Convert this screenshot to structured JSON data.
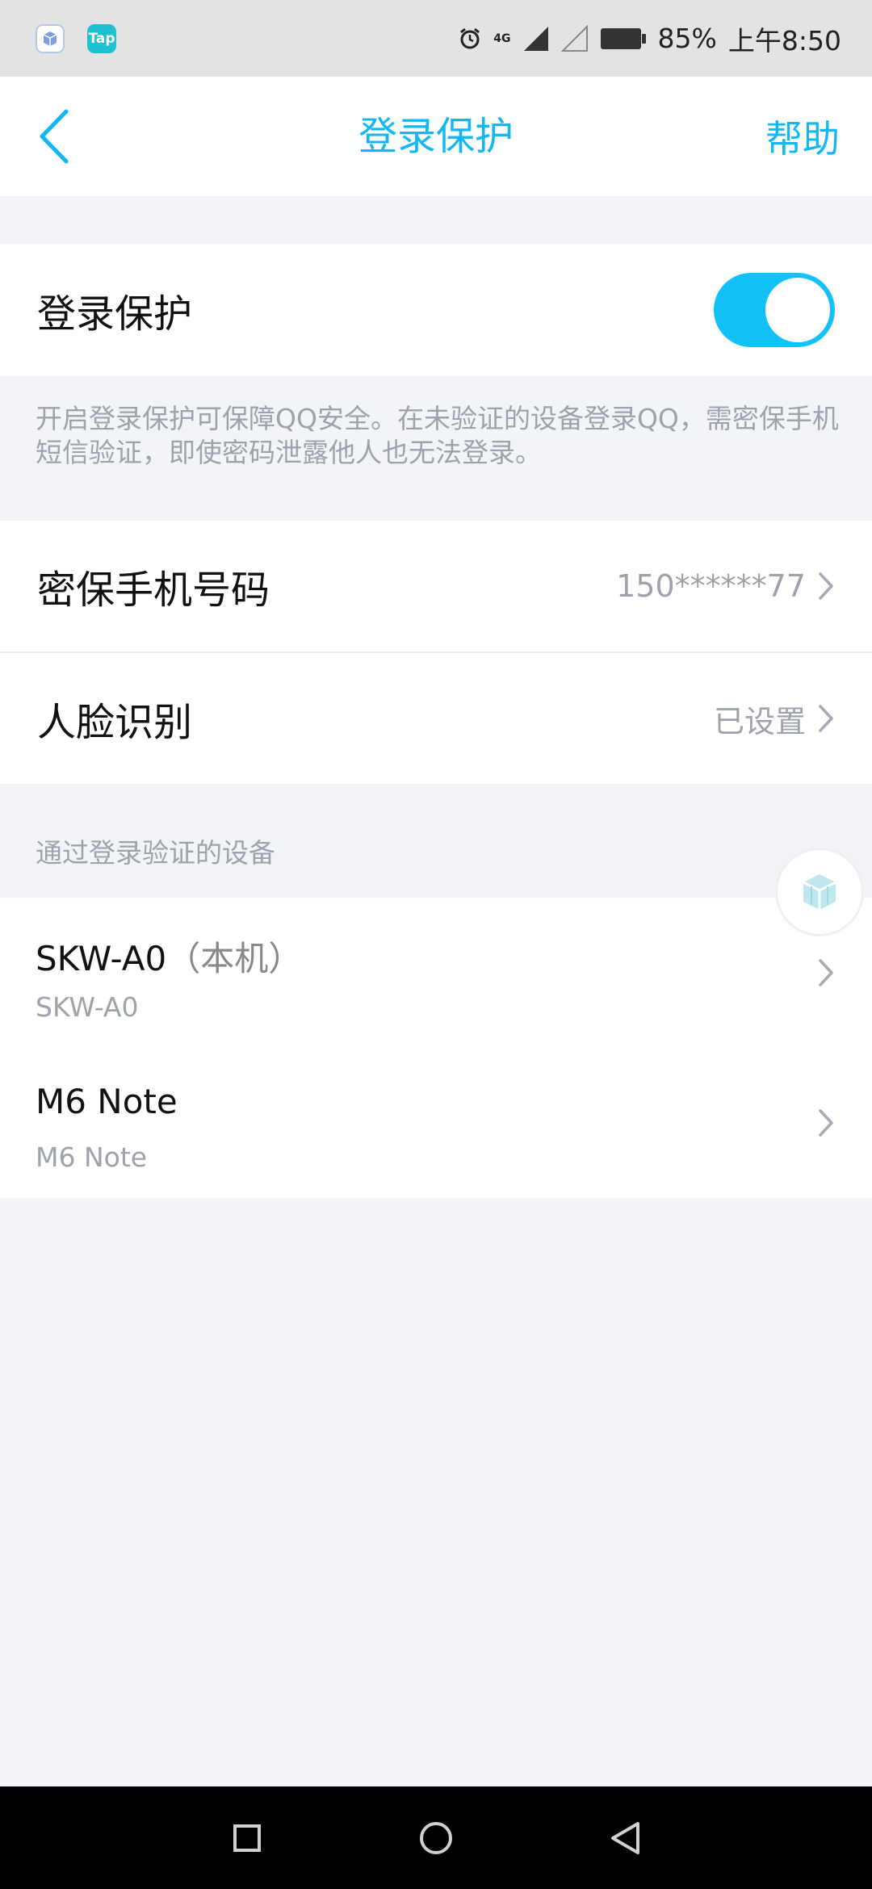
{
  "status_bar": {
    "battery_percent": "85%",
    "time": "上午8:50",
    "network_label": "4G",
    "tap_badge": "Tap",
    "icons": [
      "app-cube-icon",
      "tap-app-icon",
      "alarm-icon",
      "signal-icon",
      "signal-empty-icon",
      "battery-icon"
    ]
  },
  "nav": {
    "title": "登录保护",
    "help": "帮助",
    "back_icon": "chevron-left-icon"
  },
  "login_protect": {
    "label": "登录保护",
    "enabled": true,
    "description": "开启登录保护可保障QQ安全。在未验证的设备登录QQ，需密保手机短信验证，即使密码泄露他人也无法登录。"
  },
  "security_phone": {
    "label": "密保手机号码",
    "value": "150******77"
  },
  "face_recognition": {
    "label": "人脸识别",
    "value": "已设置"
  },
  "devices_section": {
    "title": "通过登录验证的设备",
    "items": [
      {
        "name": "SKW-A0",
        "suffix": "（本机）",
        "model": "SKW-A0"
      },
      {
        "name": "M6 Note",
        "suffix": "",
        "model": "M6 Note"
      }
    ]
  },
  "colors": {
    "accent": "#12b7f5",
    "toggle_on": "#12c2f7",
    "secondary_text": "#9ea3ab",
    "background": "#f3f4f8"
  }
}
